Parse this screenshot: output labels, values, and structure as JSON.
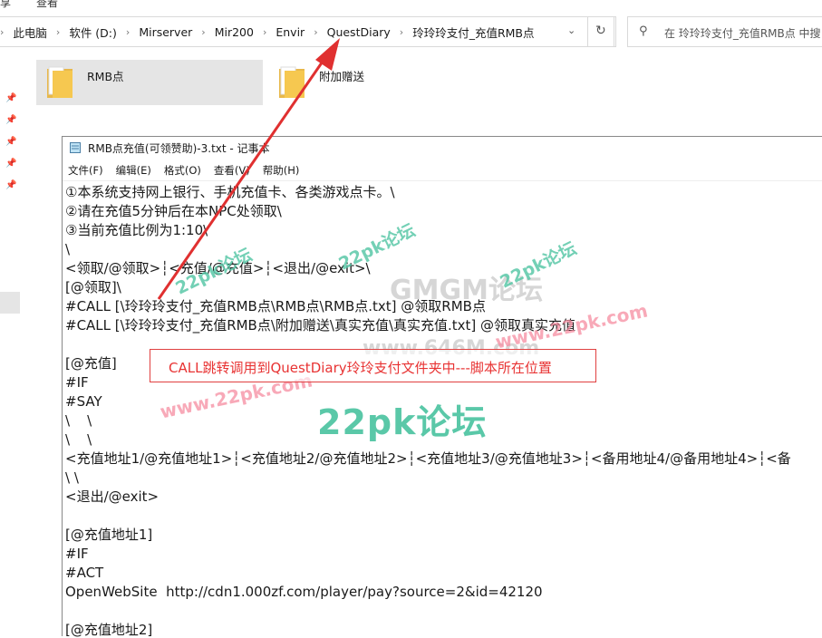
{
  "ribbon": {
    "share": "享",
    "view": "查看"
  },
  "address": {
    "crumbs": [
      "此电脑",
      "软件 (D:)",
      "Mirserver",
      "Mir200",
      "Envir",
      "QuestDiary",
      "玲玲玲支付_充值RMB点"
    ]
  },
  "search": {
    "placeholder": "在 玲玲玲支付_充值RMB点 中搜"
  },
  "folders": [
    {
      "name": "RMB点"
    },
    {
      "name": "附加赠送"
    }
  ],
  "notepad": {
    "title": "RMB点充值(可领赞助)-3.txt - 记事本",
    "menu": [
      "文件(F)",
      "编辑(E)",
      "格式(O)",
      "查看(V)",
      "帮助(H)"
    ],
    "lines": [
      "①本系统支持网上银行、手机充值卡、各类游戏点卡。\\",
      "②请在充值5分钟后在本NPC处领取\\",
      "③当前充值比例为1:10\\",
      "\\",
      "<领取/@领取>┆<充值/@充值>┆<退出/@exit>\\",
      "[@领取]\\",
      "#CALL [\\玲玲玲支付_充值RMB点\\RMB点\\RMB点.txt] @领取RMB点",
      "#CALL [\\玲玲玲支付_充值RMB点\\附加赠送\\真实充值\\真实充值.txt] @领取真实充值",
      "",
      "[@充值]",
      "#IF",
      "#SAY",
      "\\    \\",
      "\\    \\",
      "<充值地址1/@充值地址1>┆<充值地址2/@充值地址2>┆<充值地址3/@充值地址3>┆<备用地址4/@备用地址4>┆<备",
      "\\ \\",
      "<退出/@exit>",
      "",
      "[@充值地址1]",
      "#IF",
      "#ACT",
      "OpenWebSite  http://cdn1.000zf.com/player/pay?source=2&id=42120",
      "",
      "[@充值地址2]"
    ]
  },
  "annotation": {
    "text": "CALL跳转调用到QuestDiary玲玲支付文件夹中---脚本所在位置"
  },
  "watermarks": {
    "big": "22pk论坛",
    "small": "22pk论坛",
    "url": "www.22pk.com",
    "mid": "GMGM论坛",
    "mid2": "www.646M.com"
  },
  "colors": {
    "annotation_red": "#e04040",
    "watermark_green": "#5ac8a8",
    "folder_yellow": "#f6c850"
  }
}
